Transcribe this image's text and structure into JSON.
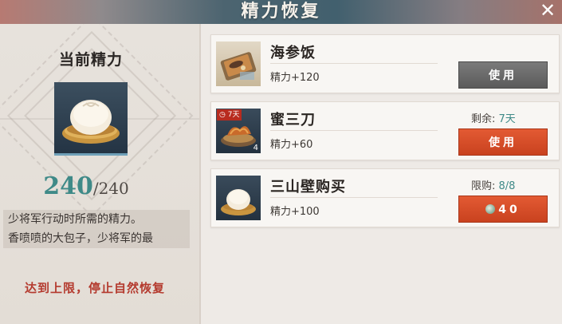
{
  "header": {
    "title": "精力恢复",
    "close_icon": "close-icon"
  },
  "left_panel": {
    "label": "当前精力",
    "item_icon": "steamed-bun-icon",
    "energy_current": "240",
    "energy_max": "/240",
    "description_line1": "少将军行动时所需的精力。",
    "description_line2": "香喷喷的大包子，少将军的最",
    "status_text": "达到上限，停止自然恢复"
  },
  "items": [
    {
      "name": "海参饭",
      "effect": "精力+120",
      "icon": "sea-cucumber-rice-icon",
      "button_label": "使用",
      "button_state": "disabled"
    },
    {
      "name": "蜜三刀",
      "effect": "精力+60",
      "icon": "honey-pastry-icon",
      "badge": "7天",
      "quantity": "4",
      "note_label": "剩余:",
      "note_value": "7天",
      "button_label": "使用"
    },
    {
      "name": "三山壁购买",
      "effect": "精力+100",
      "icon": "steamed-bun-icon",
      "note_label": "限购:",
      "note_value": "8/8",
      "button_label": "40",
      "currency_icon": "jade-coin-icon"
    }
  ],
  "colors": {
    "accent_teal": "#3f8a88",
    "button_red": "#d94e2a",
    "button_gray": "#6b6b6b",
    "warning_red": "#b43a2e"
  }
}
